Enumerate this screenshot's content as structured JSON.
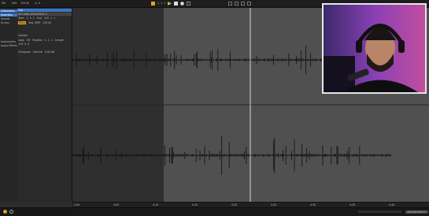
{
  "menu": {
    "file": "File",
    "edit": "Edit",
    "view": "View",
    "help": "Help"
  },
  "transport": {
    "tempo": "120.00",
    "meter": "4 / 4",
    "position": "1. 1. 1"
  },
  "sidebar": {
    "header": "Collections",
    "items": [
      "Favorites",
      "Sounds",
      "Drums",
      "Instruments",
      "Audio Effects"
    ],
    "active_index": 0
  },
  "clip": {
    "title": "Clip",
    "name": "SD CARD (PIC/VOICE 1)",
    "fields": [
      {
        "label": "Start",
        "value": "1. 1. 1"
      },
      {
        "label": "End",
        "value": "120. 1. 1"
      },
      {
        "label": "Loop",
        "value": "Off"
      },
      {
        "label": "Position",
        "value": "1. 1. 1"
      },
      {
        "label": "Length",
        "value": "119. 0. 0"
      }
    ],
    "sample": {
      "title": "Sample",
      "warp": "Warp",
      "seg_bpm": "Seg. BPM",
      "bpm_value": "120.00"
    },
    "controls": {
      "transpose": "Transpose",
      "detune": "Detune",
      "gain": "0.00 dB"
    }
  },
  "timeline": {
    "labels": [
      "0:00",
      "0:05",
      "0:10",
      "0:15",
      "0:20",
      "0:25",
      "0:30",
      "0:35",
      "0:40"
    ]
  },
  "statusbar": {
    "track": "ARRANGEMENT"
  },
  "colors": {
    "accent": "#e8a020",
    "selection": "#3a76c4",
    "waveform": "#151515",
    "webcam_bg": "#6a3fa0"
  }
}
